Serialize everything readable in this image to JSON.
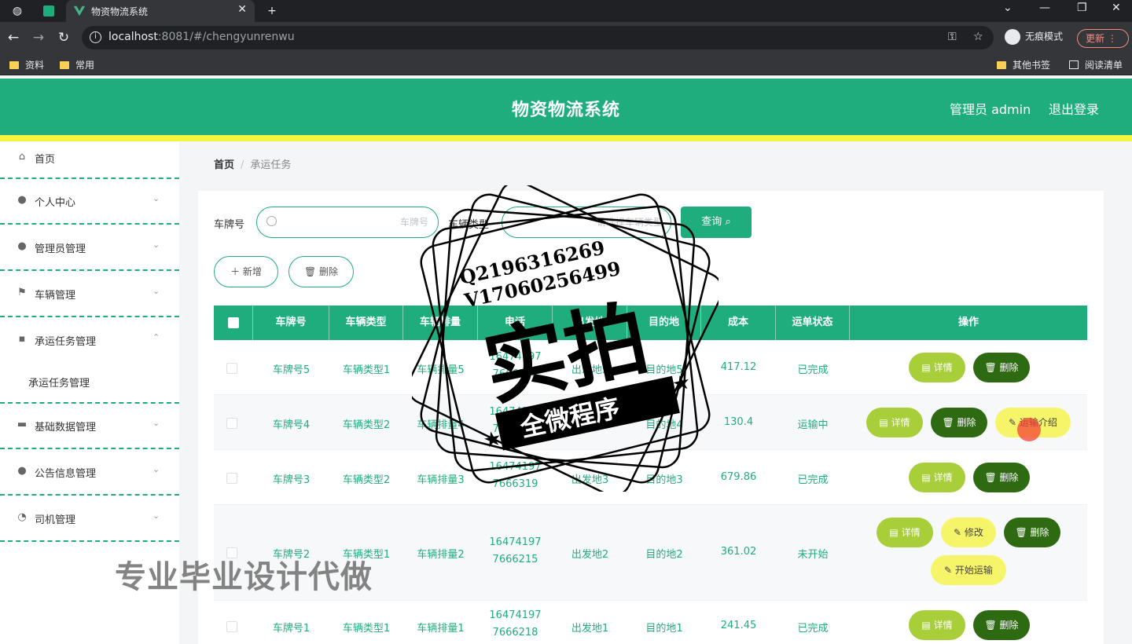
{
  "browser": {
    "tab_title": "物资物流系统",
    "url_host": "localhost",
    "url_rest": ":8081/#/chengyunrenwu",
    "incognito_label": "无痕模式",
    "update_label": "更新",
    "bookmarks": [
      "资料",
      "常用"
    ],
    "bookmarks_right": [
      "其他书签",
      "阅读清单"
    ]
  },
  "header": {
    "title": "物资物流系统",
    "user_label": "管理员 admin",
    "logout_label": "退出登录"
  },
  "sidebar": {
    "items": [
      {
        "label": "首页",
        "icon": "home-icon"
      },
      {
        "label": "个人中心",
        "icon": "user-icon"
      },
      {
        "label": "管理员管理",
        "icon": "admin-icon"
      },
      {
        "label": "车辆管理",
        "icon": "flag-icon"
      },
      {
        "label": "承运任务管理",
        "icon": "chat-icon"
      },
      {
        "label": "承运任务管理",
        "icon": ""
      },
      {
        "label": "基础数据管理",
        "icon": "briefcase-icon"
      },
      {
        "label": "公告信息管理",
        "icon": "bulb-icon"
      },
      {
        "label": "司机管理",
        "icon": "gauge-icon"
      }
    ]
  },
  "breadcrumb": {
    "home": "首页",
    "sep": "/",
    "current": "承运任务"
  },
  "search": {
    "plate_label": "车牌号",
    "plate_placeholder": "车牌号",
    "type_label": "车辆类型",
    "type_placeholder": "请选择车辆类型",
    "query_label": "查询"
  },
  "actions": {
    "add_label": "新增",
    "delete_label": "删除"
  },
  "table": {
    "columns": [
      "车牌号",
      "车辆类型",
      "车辆排量",
      "电话",
      "出发地",
      "目的地",
      "成本",
      "运单状态",
      "操作"
    ],
    "rows": [
      {
        "plate": "车牌号5",
        "type": "车辆类型1",
        "disp": "车辆排量5",
        "phone1": "16474197",
        "phone2": "7666300",
        "from": "出发地5",
        "to": "目的地5",
        "cost": "417.12",
        "status": "已完成"
      },
      {
        "plate": "车牌号4",
        "type": "车辆类型2",
        "disp": "车辆排量4",
        "phone1": "16474197",
        "phone2": "7666310",
        "from": "出发地4",
        "to": "目的地4",
        "cost": "130.4",
        "status": "运输中"
      },
      {
        "plate": "车牌号3",
        "type": "车辆类型2",
        "disp": "车辆排量3",
        "phone1": "16474197",
        "phone2": "7666319",
        "from": "出发地3",
        "to": "目的地3",
        "cost": "679.86",
        "status": "已完成"
      },
      {
        "plate": "车牌号2",
        "type": "车辆类型1",
        "disp": "车辆排量2",
        "phone1": "16474197",
        "phone2": "7666215",
        "from": "出发地2",
        "to": "目的地2",
        "cost": "361.02",
        "status": "未开始"
      },
      {
        "plate": "车牌号1",
        "type": "车辆类型1",
        "disp": "车辆排量1",
        "phone1": "16474197",
        "phone2": "7666218",
        "from": "出发地1",
        "to": "目的地1",
        "cost": "241.45",
        "status": "已完成"
      }
    ],
    "ops": {
      "detail": "详情",
      "delete": "删除",
      "edit": "修改",
      "intro": "运输介绍",
      "start": "开始运输"
    }
  },
  "watermark": {
    "qq": "Q2196316269",
    "vx": "V17060256499",
    "main": "实拍",
    "sub": "全微程序",
    "bottom": "专业毕业设计代做"
  },
  "colors": {
    "primary": "#1fad7e",
    "yellow_bar": "#f5f53d",
    "detail_btn": "#a8cf3a",
    "delete_btn": "#2d6a12",
    "yellow_btn": "#f6f56a"
  }
}
